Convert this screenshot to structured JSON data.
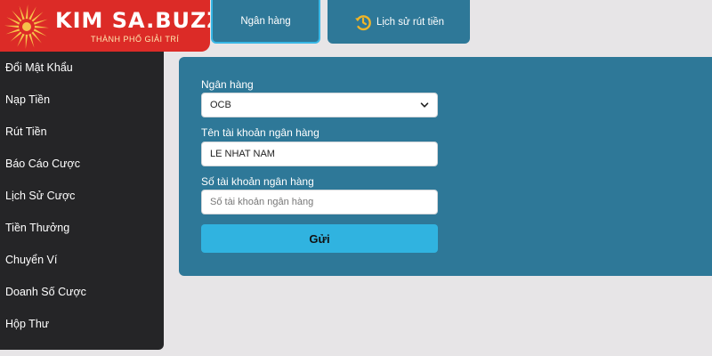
{
  "logo": {
    "brand": "KIM SA.BUZZ",
    "tagline": "THÀNH PHỐ GIẢI TRÍ"
  },
  "sidebar": {
    "items": [
      {
        "label": "Đổi Mật Khẩu"
      },
      {
        "label": "Nạp Tiền"
      },
      {
        "label": "Rút Tiền"
      },
      {
        "label": "Báo Cáo Cược"
      },
      {
        "label": "Lịch Sử Cược"
      },
      {
        "label": "Tiền Thưởng"
      },
      {
        "label": "Chuyển Ví"
      },
      {
        "label": "Doanh Số Cược"
      },
      {
        "label": "Hộp Thư"
      }
    ]
  },
  "tabs": {
    "bank": "Ngân hàng",
    "history": "Lịch sử rút tiền"
  },
  "form": {
    "bank_label": "Ngân hàng",
    "bank_value": "OCB",
    "account_name_label": "Tên tài khoản ngân hàng",
    "account_name_value": "LE NHAT NAM",
    "account_number_label": "Số tài khoản ngân hàng",
    "account_number_placeholder": "Số tài khoản ngân hàng",
    "submit_label": "Gửi"
  },
  "colors": {
    "brand_red": "#dc2b27",
    "panel_blue": "#2e7898",
    "button_blue": "#30b3e0",
    "sidebar_dark": "#252527",
    "history_icon_gold": "#f0b528"
  },
  "icons": {
    "logo": "sunburst-logo-icon",
    "history_tab": "history-clock-icon",
    "select": "chevron-down-icon"
  }
}
